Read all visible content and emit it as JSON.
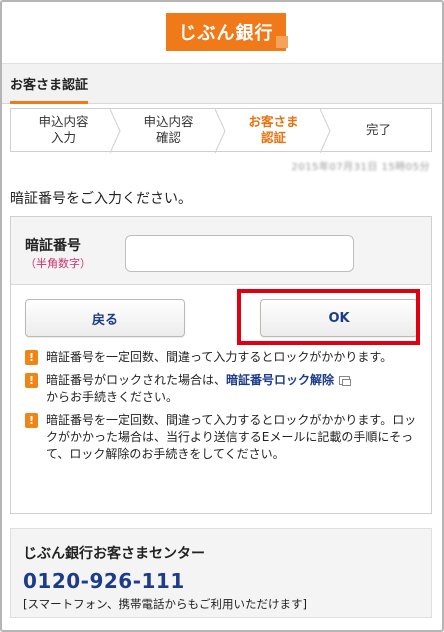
{
  "header": {
    "logo_text": "じぶん銀行"
  },
  "page": {
    "heading": "お客さま認証",
    "instruction": "暗証番号をご入力ください。",
    "datetime_blurred": "2015年07月31日 15時05分"
  },
  "steps": [
    {
      "label": "申込内容\n入力",
      "active": false
    },
    {
      "label": "申込内容\n確認",
      "active": false
    },
    {
      "label": "お客さま\n認証",
      "active": true
    },
    {
      "label": "完了",
      "active": false
    }
  ],
  "form": {
    "pin_label": "暗証番号",
    "pin_sublabel": "（半角数字）",
    "pin_value": "",
    "back_button": "戻る",
    "ok_button": "OK"
  },
  "notes": [
    {
      "text": "暗証番号を一定回数、間違って入力するとロックがかかります。"
    },
    {
      "text_before": "暗証番号がロックされた場合は、",
      "link": "暗証番号ロック解除",
      "text_after": "からお手続きください。"
    },
    {
      "text": "暗証番号を一定回数、間違って入力するとロックがかかります。ロックがかかった場合は、当行より送信するEメールに記載の手順にそって、ロック解除のお手続きをしてください。"
    }
  ],
  "contact": {
    "title": "じぶん銀行お客さまセンター",
    "phone": "0120-926-111",
    "note": "[スマートフォン、携帯電話からもご利用いただけます]"
  },
  "colors": {
    "brand_orange": "#f07a1a",
    "link_blue": "#1c3b8a",
    "highlight_red": "#e10010",
    "sublabel_pink": "#c8326f"
  },
  "icons": {
    "warning": "exclamation-icon",
    "external": "external-window-icon"
  }
}
